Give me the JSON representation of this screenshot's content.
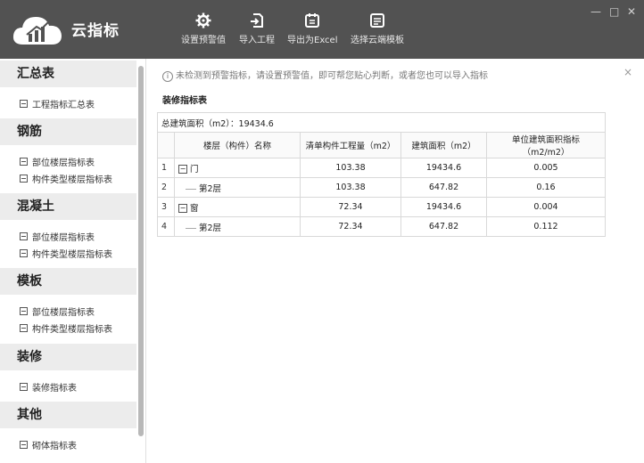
{
  "app": {
    "name": "云指标"
  },
  "toolbar": [
    {
      "label": "设置预警值",
      "icon": "gear-icon"
    },
    {
      "label": "导入工程",
      "icon": "import-icon"
    },
    {
      "label": "导出为Excel",
      "icon": "export-excel-icon"
    },
    {
      "label": "选择云端模板",
      "icon": "template-icon"
    }
  ],
  "window_controls": {
    "minimize": "—",
    "maximize": "□",
    "close": "✕"
  },
  "sidebar": {
    "sections": [
      {
        "title": "汇总表",
        "items": [
          "工程指标汇总表"
        ]
      },
      {
        "title": "钢筋",
        "items": [
          "部位楼层指标表",
          "构件类型楼层指标表"
        ]
      },
      {
        "title": "混凝土",
        "items": [
          "部位楼层指标表",
          "构件类型楼层指标表"
        ]
      },
      {
        "title": "模板",
        "items": [
          "部位楼层指标表",
          "构件类型楼层指标表"
        ]
      },
      {
        "title": "装修",
        "items": [
          "装修指标表"
        ]
      },
      {
        "title": "其他",
        "items": [
          "砌体指标表"
        ]
      }
    ]
  },
  "main": {
    "notice": "未检测到预警指标，请设置预警值，即可帮您贴心判断，或者您也可以导入指标",
    "notice_close": "×",
    "table_title": "装修指标表",
    "summary": "总建筑面积（m2）：19434.6",
    "columns": [
      "楼层（构件）名称",
      "清单构件工程量（m2）",
      "建筑面积（m2）",
      "单位建筑面积指标（m2/m2）"
    ],
    "rows": [
      {
        "num": "1",
        "name": "门",
        "toggle": "−",
        "qty": "103.38",
        "area": "19434.6",
        "index": "0.005"
      },
      {
        "num": "2",
        "name": "第2层",
        "qty": "103.38",
        "area": "647.82",
        "index": "0.16"
      },
      {
        "num": "3",
        "name": "窗",
        "toggle": "−",
        "qty": "72.34",
        "area": "19434.6",
        "index": "0.004"
      },
      {
        "num": "4",
        "name": "第2层",
        "qty": "72.34",
        "area": "647.82",
        "index": "0.112"
      }
    ]
  }
}
